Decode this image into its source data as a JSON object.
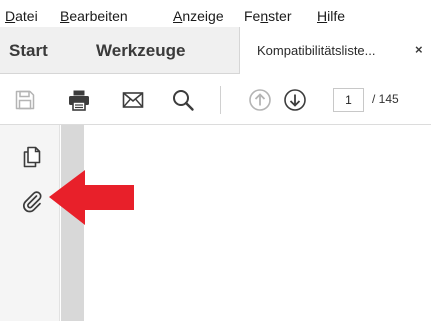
{
  "menu": {
    "items": [
      {
        "accel": "D",
        "rest": "atei"
      },
      {
        "accel": "B",
        "rest": "earbeiten"
      },
      {
        "accel": "A",
        "rest": "nzeige"
      },
      {
        "pre": "Fe",
        "accel": "n",
        "rest": "ster"
      },
      {
        "accel": "H",
        "rest": "ilfe"
      }
    ]
  },
  "tabs": {
    "start": "Start",
    "tools": "Werkzeuge",
    "document": "Kompatibilitätsliste...",
    "close": "×"
  },
  "toolbar": {
    "icons": [
      "save-icon",
      "print-icon",
      "email-icon",
      "search-icon",
      "page-up-icon",
      "page-down-icon"
    ],
    "page_current": "1",
    "page_total": "/ 145"
  },
  "sidepanel": {
    "icons": [
      "page-thumbnails-icon",
      "attachments-icon"
    ]
  },
  "annotation": {
    "arrow_color": "#e8202a"
  }
}
